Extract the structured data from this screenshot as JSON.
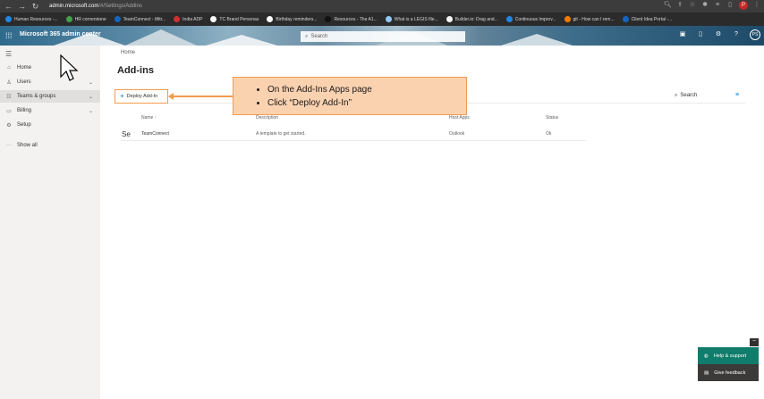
{
  "browser": {
    "url_host": "admin.microsoft.com",
    "url_path": "/#/Settings/AddIns",
    "profile_initial": "P"
  },
  "bookmarks": [
    {
      "label": "Human Resources -...",
      "color": "#1e88e5"
    },
    {
      "label": "HR cornerstone",
      "color": "#43a047"
    },
    {
      "label": "TeamConnect - Mitr...",
      "color": "#1565c0"
    },
    {
      "label": "India ADP",
      "color": "#d32f2f"
    },
    {
      "label": "TC Brand Personas",
      "color": "#ffffff"
    },
    {
      "label": "Birthday reminders...",
      "color": "#ffffff"
    },
    {
      "label": "Resources - The A1...",
      "color": "#111111"
    },
    {
      "label": "What is a LEGIS file...",
      "color": "#90caf9"
    },
    {
      "label": "Builder.io: Drag and...",
      "color": "#f5f5f5"
    },
    {
      "label": "Continuous Improv...",
      "color": "#1e88e5"
    },
    {
      "label": "git - How can I rem...",
      "color": "#f57c00"
    },
    {
      "label": "Client Idea Portal -...",
      "color": "#1565c0"
    }
  ],
  "header": {
    "app_name": "Microsoft 365 admin center",
    "search_placeholder": "Search",
    "avatar_initials": "PS"
  },
  "sidebar": {
    "items": [
      {
        "label": "Home",
        "icon": "home-icon",
        "glyph": "⌂",
        "chevron": false,
        "selected": false
      },
      {
        "label": "Users",
        "icon": "user-icon",
        "glyph": "♙",
        "chevron": true,
        "selected": false
      },
      {
        "label": "Teams & groups",
        "icon": "teams-icon",
        "glyph": "☷",
        "chevron": true,
        "selected": true
      },
      {
        "label": "Billing",
        "icon": "billing-icon",
        "glyph": "▭",
        "chevron": true,
        "selected": false
      },
      {
        "label": "Setup",
        "icon": "setup-icon",
        "glyph": "⚙",
        "chevron": false,
        "selected": false
      },
      {
        "label": "Show all",
        "icon": "more-icon",
        "glyph": "···",
        "chevron": false,
        "selected": false
      }
    ]
  },
  "main": {
    "breadcrumb": "Home",
    "title": "Add-ins",
    "deploy_button": "Deploy Add-In",
    "search_label": "Search",
    "columns": [
      "Name ↑",
      "Description",
      "Host Apps",
      "Status"
    ],
    "rows": [
      {
        "icon_alt": "Se",
        "name": "TeamConnect",
        "description": "A template to get started.",
        "host_apps": "Outlook",
        "status": "Ok"
      }
    ]
  },
  "callout": {
    "lines": [
      "On the Add-Ins Apps page",
      "Click “Deploy Add-In”"
    ],
    "color": "#f29b4b"
  },
  "help": {
    "help_label": "Help & support",
    "feedback_label": "Give feedback",
    "minimize": "−"
  }
}
